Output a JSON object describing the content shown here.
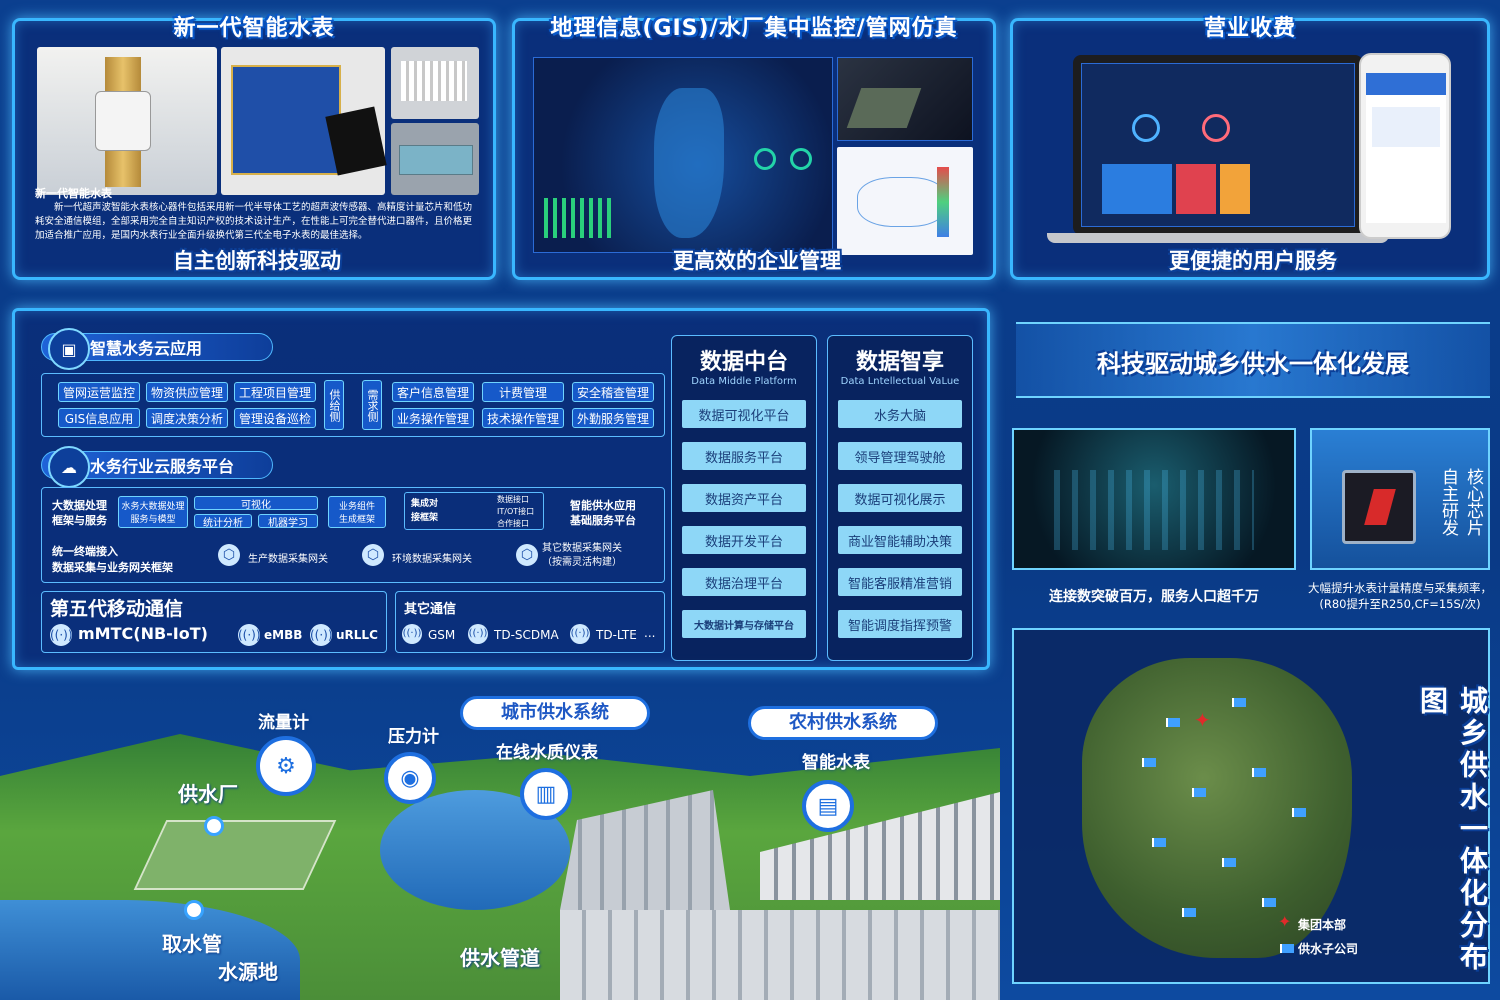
{
  "top": {
    "meter": {
      "title": "新一代智能水表",
      "caption_title": "新一代智能水表",
      "caption_body": "新一代超声波智能水表核心器件包括采用新一代半导体工艺的超声波传感器、高精度计量芯片和低功耗安全通信模组，全部采用完全自主知识产权的技术设计生产，在性能上可完全替代进口器件，且价格更加适合推广应用，是国内水表行业全面升级换代第三代全电子水表的最佳选择。",
      "slogan": "自主创新科技驱动"
    },
    "gis": {
      "title": "地理信息(GIS)/水厂集中监控/管网仿真",
      "slogan": "更高效的企业管理"
    },
    "billing": {
      "title": "营业收费",
      "slogan": "更便捷的用户服务"
    }
  },
  "platform": {
    "cloud_app": {
      "title": "智慧水务云应用",
      "left_items": [
        "管网运营监控",
        "物资供应管理",
        "工程项目管理",
        "GIS信息应用",
        "调度决策分析",
        "管理设备巡检"
      ],
      "supply_side": "供给侧",
      "demand_side": "需求侧",
      "right_items": [
        "客户信息管理",
        "计费管理",
        "安全稽查管理",
        "业务操作管理",
        "技术操作管理",
        "外勤服务管理"
      ]
    },
    "industry_cloud": {
      "title": "水务行业云服务平台",
      "bigdata_label": "大数据处理\n框架与服务",
      "bigdata_model": "水务大数据处理\n服务与模型",
      "visual": "可视化",
      "stats": "统计分析",
      "ml": "机器学习",
      "biz_component": "业务组件\n生成框架",
      "integrate": "集成对\n接框架",
      "ports": [
        "数据接口",
        "IT/OT接口",
        "合作接口"
      ],
      "smart_supply": "智能供水应用\n基础服务平台",
      "terminal_label": "统一终端接入\n数据采集与业务网关框架",
      "gateways": [
        "生产数据采集网关",
        "环境数据采集网关",
        "其它数据采集网关\n（按需灵活构建）"
      ]
    },
    "fifth_gen": {
      "title": "第五代移动通信",
      "items": [
        "mMTC(NB-IoT)",
        "eMBB",
        "uRLLC"
      ]
    },
    "other_comm": {
      "title": "其它通信",
      "items": [
        "GSM",
        "TD-SCDMA",
        "TD-LTE",
        "..."
      ]
    },
    "data_mid": {
      "title": "数据中台",
      "subtitle": "Data Middle Platform",
      "items": [
        "数据可视化平台",
        "数据服务平台",
        "数据资产平台",
        "数据开发平台",
        "数据治理平台",
        "大数据计算与存储平台"
      ]
    },
    "data_share": {
      "title": "数据智享",
      "subtitle": "Data Lntellectual VaLue",
      "items": [
        "水务大脑",
        "领导管理驾驶舱",
        "数据可视化展示",
        "商业智能辅助决策",
        "智能客服精准营销",
        "智能调度指挥预警"
      ]
    }
  },
  "right": {
    "banner": "科技驱动城乡供水一体化发展",
    "city_caption": "连接数突破百万，服务人口超千万",
    "chip_label": "核心芯片\n自主研发",
    "chip_caption": "大幅提升水表计量精度与采集频率，\n(R80提升至R250,CF=15S/次)",
    "map_title": "城乡供水一体化分布图",
    "legend_hq": "集团本部",
    "legend_sub": "供水子公司"
  },
  "scene": {
    "city_system": "城市供水系统",
    "rural_system": "农村供水系统",
    "flowmeter": "流量计",
    "pressure": "压力计",
    "quality": "在线水质仪表",
    "smart_meter": "智能水表",
    "plant": "供水厂",
    "intake": "取水管",
    "source": "水源地",
    "pipe": "供水管道"
  },
  "icons": {
    "cloud_app": "monitor-icon",
    "industry_cloud": "cloud-icon",
    "gateway": "hexagon-icon",
    "signal": "signal-icon"
  }
}
